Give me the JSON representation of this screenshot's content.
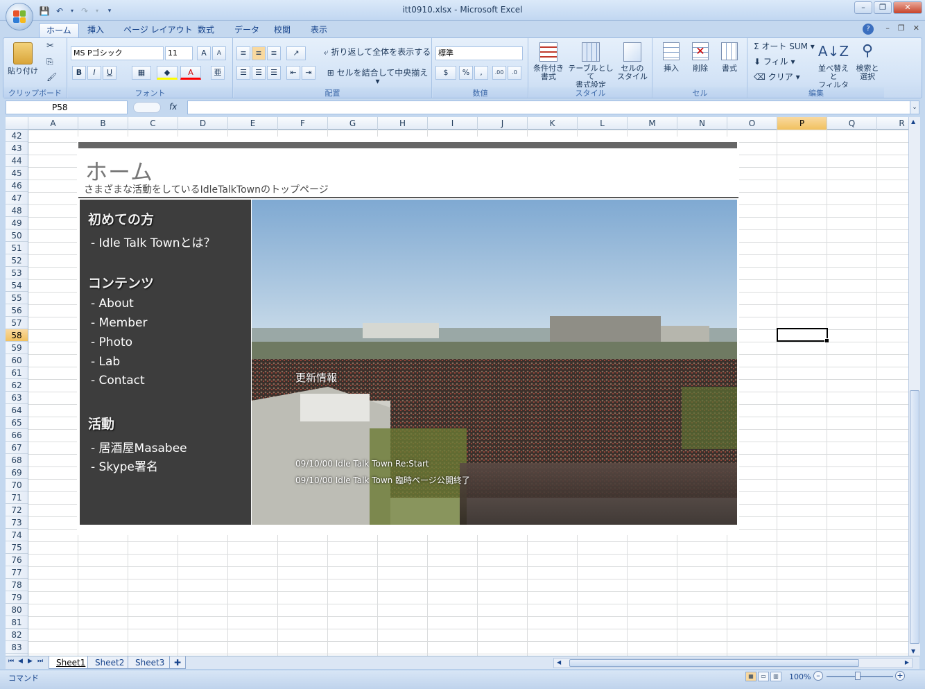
{
  "window": {
    "title": "itt0910.xlsx - Microsoft Excel"
  },
  "tabs": [
    "ホーム",
    "挿入",
    "ページ レイアウト",
    "数式",
    "データ",
    "校閲",
    "表示"
  ],
  "ribbon": {
    "clipboard": {
      "label": "クリップボード",
      "paste": "貼り付け"
    },
    "font": {
      "label": "フォント",
      "name": "MS Pゴシック",
      "size": "11"
    },
    "alignment": {
      "label": "配置",
      "wrap": "折り返して全体を表示する",
      "merge": "セルを結合して中央揃え"
    },
    "number": {
      "label": "数値",
      "format": "標準"
    },
    "styles": {
      "label": "スタイル",
      "conditional": "条件付き\n書式",
      "table": "テーブルとして\n書式設定",
      "cell": "セルの\nスタイル"
    },
    "cells": {
      "label": "セル",
      "insert": "挿入",
      "delete": "削除",
      "format": "書式"
    },
    "editing": {
      "label": "編集",
      "autosum": "オート SUM",
      "fill": "フィル",
      "clear": "クリア",
      "sort": "並べ替えと\nフィルタ",
      "find": "検索と\n選択"
    }
  },
  "formula_bar": {
    "name_box": "P58",
    "fx": "fx",
    "value": ""
  },
  "columns": [
    "A",
    "B",
    "C",
    "D",
    "E",
    "F",
    "G",
    "H",
    "I",
    "J",
    "K",
    "L",
    "M",
    "N",
    "O",
    "P",
    "Q",
    "R"
  ],
  "selected_column": "P",
  "rows": [
    "42",
    "43",
    "44",
    "45",
    "46",
    "47",
    "48",
    "49",
    "50",
    "51",
    "52",
    "53",
    "54",
    "55",
    "56",
    "57",
    "58",
    "59",
    "60",
    "61",
    "62",
    "63",
    "64",
    "65",
    "66",
    "67",
    "68",
    "69",
    "70",
    "71",
    "72",
    "73",
    "74",
    "75",
    "76",
    "77",
    "78",
    "79",
    "80",
    "81",
    "82",
    "83"
  ],
  "selected_row": "58",
  "page": {
    "title": "ホーム",
    "subtitle": "さまざまな活動をしているIdleTalkTownのトップページ",
    "sidebar": [
      {
        "heading": "初めての方",
        "links": [
          "- Idle Talk Townとは？"
        ]
      },
      {
        "heading": "コンテンツ",
        "links": [
          "- About",
          "- Member",
          "- Photo",
          "- Lab",
          "- Contact"
        ]
      },
      {
        "heading": "活動",
        "links": [
          "- 居酒屋Masabee",
          "- Skype署名"
        ]
      }
    ],
    "news": {
      "title": "更新情報",
      "items": [
        "09/10/00 Idle Talk Town Re:Start",
        "09/10/00 Idle Talk Town 臨時ページ公開終了"
      ]
    }
  },
  "sheets": [
    "Sheet1",
    "Sheet2",
    "Sheet3"
  ],
  "active_sheet": "Sheet1",
  "status": {
    "mode": "コマンド",
    "zoom": "100%"
  }
}
